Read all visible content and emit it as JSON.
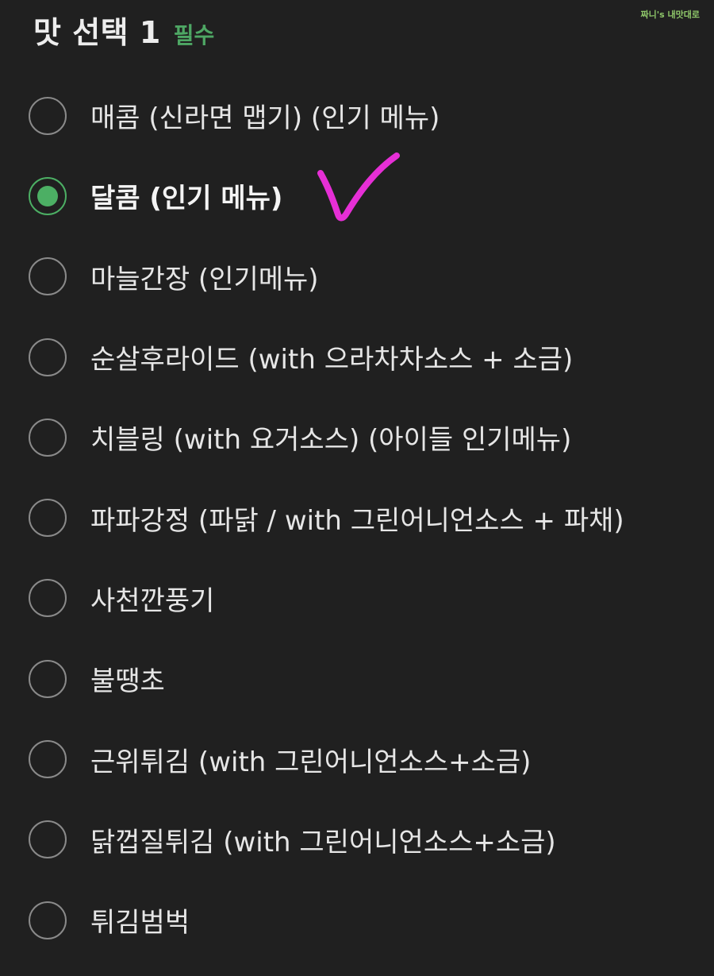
{
  "header": {
    "title": "맛 선택 1",
    "required_label": "필수",
    "watermark": "짜니's 내맛대로"
  },
  "options": [
    {
      "label": "매콤 (신라면 맵기) (인기 메뉴)",
      "selected": false
    },
    {
      "label": "달콤 (인기 메뉴)",
      "selected": true
    },
    {
      "label": "마늘간장 (인기메뉴)",
      "selected": false
    },
    {
      "label": "순살후라이드 (with 으라차차소스 + 소금)",
      "selected": false
    },
    {
      "label": "치블링 (with 요거소스) (아이들 인기메뉴)",
      "selected": false
    },
    {
      "label": "파파강정 (파닭 / with 그린어니언소스 + 파채)",
      "selected": false
    },
    {
      "label": "사천깐풍기",
      "selected": false
    },
    {
      "label": "불땡초",
      "selected": false
    },
    {
      "label": "근위튀김 (with 그린어니언소스+소금)",
      "selected": false
    },
    {
      "label": "닭껍질튀김 (with 그린어니언소스+소금)",
      "selected": false
    },
    {
      "label": "튀김범벅",
      "selected": false
    }
  ],
  "colors": {
    "background": "#202020",
    "accent_green": "#4caf64",
    "annotation_magenta": "#e62fd6"
  },
  "icons": {
    "radio": "radio-circle-icon",
    "annotation": "handdrawn-checkmark-icon"
  }
}
